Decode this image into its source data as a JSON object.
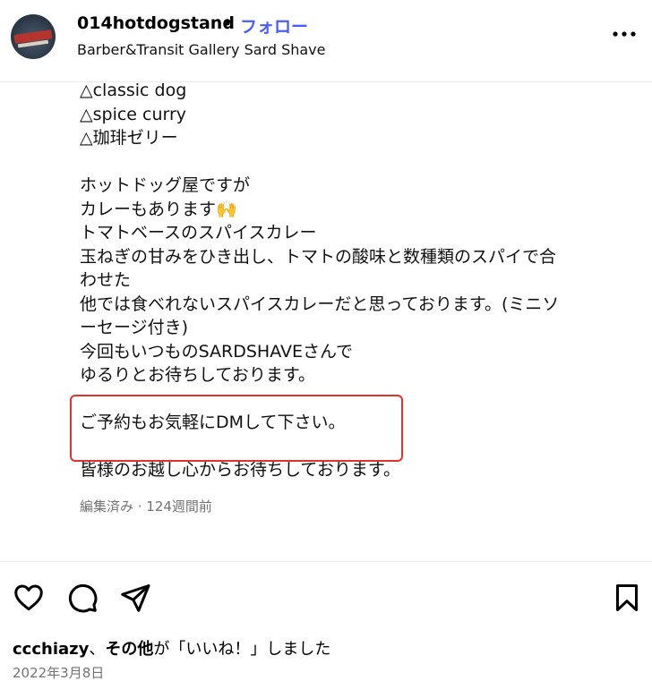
{
  "header": {
    "username": "014hotdogstand",
    "separator": "•",
    "follow_label": "フォロー",
    "location": "Barber&Transit Gallery Sard Shave",
    "more_label": "•••"
  },
  "caption": {
    "lines": [
      "△classic dog",
      "△spice curry",
      "△珈琲ゼリー",
      "",
      "ホットドッグ屋ですが",
      "カレーもあります🙌",
      "トマトベースのスパイスカレー",
      "玉ねぎの甘みをひき出し、トマトの酸味と数種類のスパイで合",
      "わせた",
      "他では食べれないスパイスカレーだと思っております。(ミニソ",
      "ーセージ付き)",
      "今回もいつものSARDSHAVEさんで",
      "ゆるりとお待ちしております。",
      "",
      "ご予約もお気軽にDMして下さい。",
      "",
      "皆様のお越し心からお待ちしております。"
    ],
    "meta": "編集済み · 124週間前"
  },
  "actions": {
    "like_icon": "heart-icon",
    "comment_icon": "comment-icon",
    "share_icon": "send-icon",
    "save_icon": "bookmark-icon"
  },
  "likes": {
    "user": "ccchiazy",
    "sep": "、",
    "others": "その他",
    "suffix": "が「いいね！」しました"
  },
  "date": "2022年3月8日",
  "colors": {
    "follow": "#4a5df9",
    "highlight": "#e0332d",
    "meta": "#737373"
  }
}
